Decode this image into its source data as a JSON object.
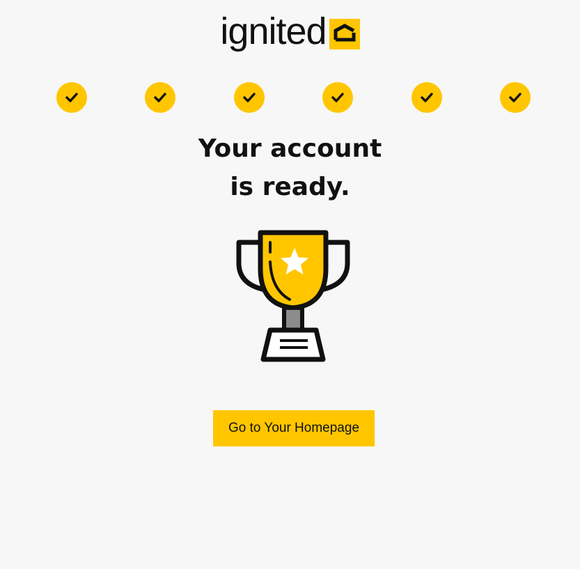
{
  "brand": {
    "logo_text": "ignited",
    "logo_icon": "ignited-mark-icon",
    "accent_color": "#ffc600"
  },
  "progress": {
    "steps_completed": 6,
    "steps_total": 6,
    "step_icon": "check-circle-icon"
  },
  "headline": {
    "line1": "Your account",
    "line2": "is ready."
  },
  "illustration": {
    "icon": "trophy-icon"
  },
  "cta": {
    "label": "Go to Your Homepage"
  }
}
